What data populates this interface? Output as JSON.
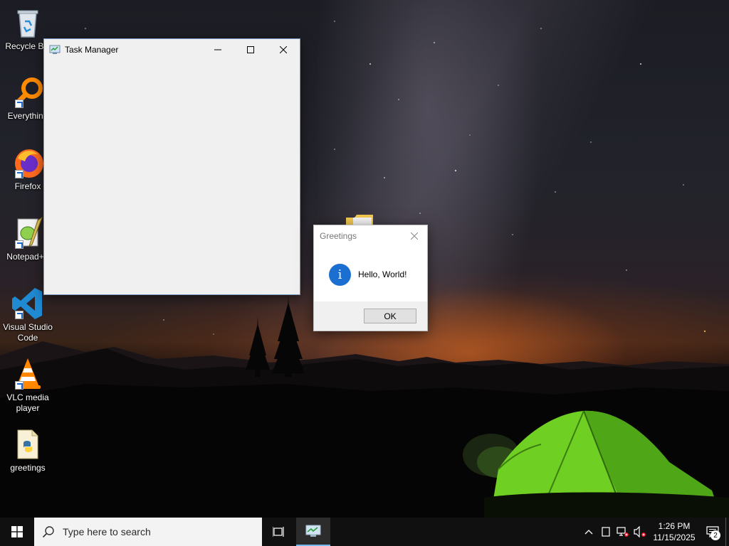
{
  "desktop": {
    "icons": [
      {
        "label": "Recycle Bin",
        "icon": "recycle-bin-icon"
      },
      {
        "label": "Everything",
        "icon": "everything-search-icon"
      },
      {
        "label": "Firefox",
        "icon": "firefox-icon"
      },
      {
        "label": "Notepad++",
        "icon": "notepad-plus-plus-icon"
      },
      {
        "label": "Visual Studio Code",
        "icon": "vscode-icon"
      },
      {
        "label": "VLC media player",
        "icon": "vlc-icon"
      },
      {
        "label": "greetings",
        "icon": "python-file-icon"
      }
    ]
  },
  "task_manager": {
    "title": "Task Manager",
    "controls": {
      "minimize": "—",
      "maximize": "☐",
      "close": "✕"
    }
  },
  "dialog": {
    "title": "Greetings",
    "message": "Hello, World!",
    "ok_label": "OK",
    "info_glyph": "i",
    "close_glyph": "✕"
  },
  "taskbar": {
    "search_placeholder": "Type here to search",
    "time": "1:26 PM",
    "date": "11/15/2025",
    "notification_count": "2"
  },
  "colors": {
    "accent": "#1a6fd0",
    "taskbar": "#101010",
    "tent_green": "#7ed321"
  }
}
